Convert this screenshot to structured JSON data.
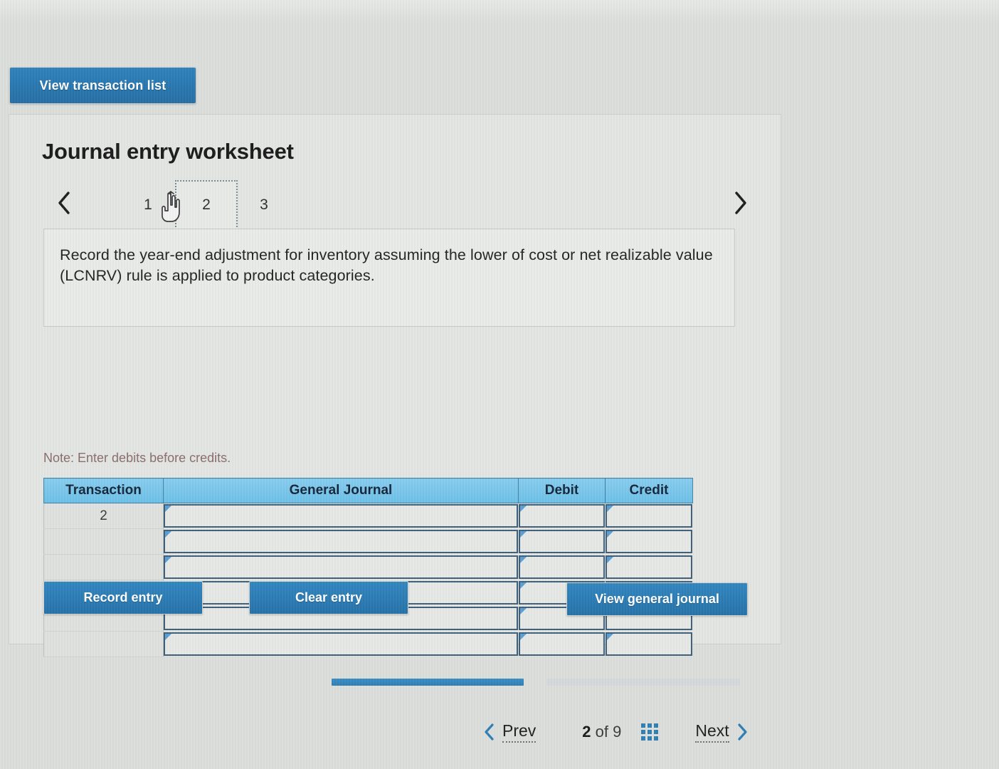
{
  "toolbar": {
    "view_transaction_list": "View transaction list"
  },
  "card": {
    "title": "Journal entry worksheet"
  },
  "worksheet_pager": {
    "prev_icon": "chevron-left-icon",
    "next_icon": "chevron-right-icon",
    "tabs": [
      {
        "label": "1",
        "selected": false
      },
      {
        "label": "2",
        "selected": true
      },
      {
        "label": "3",
        "selected": false
      }
    ],
    "cursor_icon": "pointing-hand-cursor-icon"
  },
  "instruction": {
    "text": "Record the year-end adjustment for inventory assuming the lower of cost or net realizable value (LCNRV) rule is applied to product categories."
  },
  "note": {
    "text": "Note: Enter debits before credits."
  },
  "journal_table": {
    "columns": [
      "Transaction",
      "General Journal",
      "Debit",
      "Credit"
    ],
    "rows": [
      {
        "transaction": "2",
        "general_journal": "",
        "debit": "",
        "credit": ""
      },
      {
        "transaction": "",
        "general_journal": "",
        "debit": "",
        "credit": ""
      },
      {
        "transaction": "",
        "general_journal": "",
        "debit": "",
        "credit": ""
      },
      {
        "transaction": "",
        "general_journal": "",
        "debit": "",
        "credit": ""
      },
      {
        "transaction": "",
        "general_journal": "",
        "debit": "",
        "credit": ""
      },
      {
        "transaction": "",
        "general_journal": "",
        "debit": "",
        "credit": ""
      }
    ]
  },
  "actions": {
    "record_entry": "Record entry",
    "clear_entry": "Clear entry",
    "view_general_journal": "View general journal"
  },
  "bottom_nav": {
    "prev_label": "Prev",
    "next_label": "Next",
    "current_page": "2",
    "of_label": "of",
    "total_pages": "9",
    "grid_icon": "grid-menu-icon",
    "prev_icon": "chevron-left-icon",
    "next_icon": "chevron-right-icon"
  },
  "progress": {
    "completed_percent": "47",
    "remaining_percent": "53"
  },
  "colors": {
    "page_background": "#dcdedc",
    "primary_button": "#2876ae",
    "table_header": "#6cc0e8",
    "input_border": "#3f5f78",
    "note_text": "#8a6d6b",
    "accent": "#2f7fb4"
  }
}
